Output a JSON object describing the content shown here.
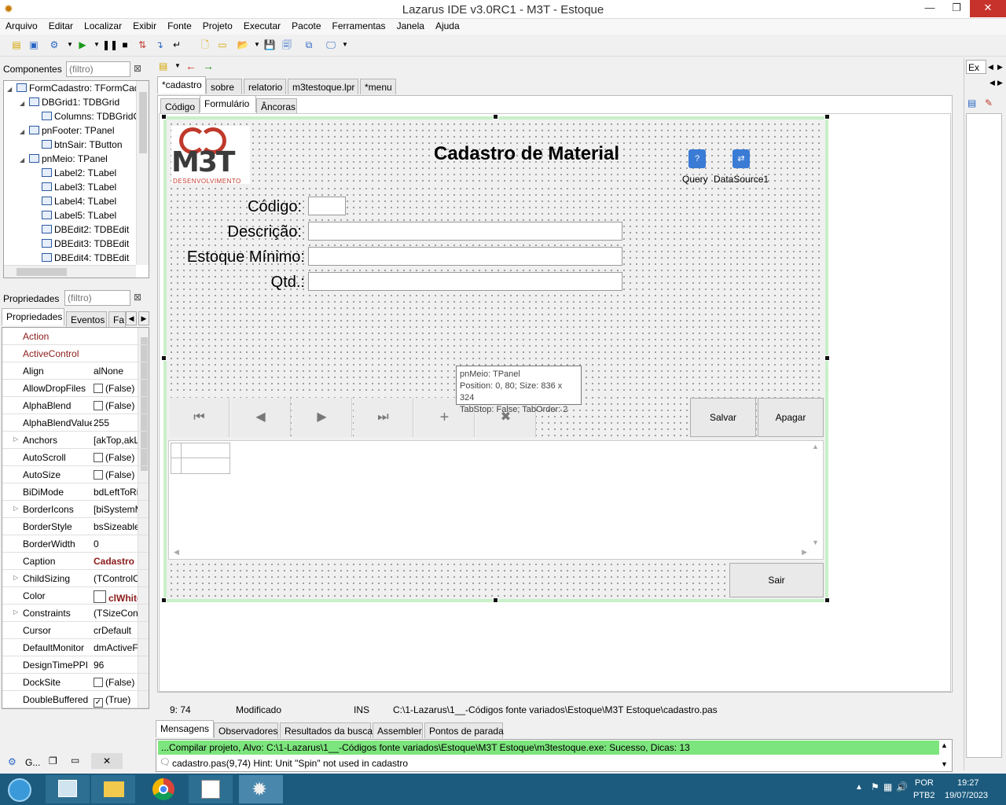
{
  "window": {
    "title": "Lazarus IDE v3.0RC1 - M3T - Estoque"
  },
  "menu": [
    "Arquivo",
    "Editar",
    "Localizar",
    "Exibir",
    "Fonte",
    "Projeto",
    "Executar",
    "Pacote",
    "Ferramentas",
    "Janela",
    "Ajuda"
  ],
  "components": {
    "label": "Componentes",
    "filter_placeholder": "(filtro)",
    "tree": [
      {
        "text": "FormCadastro: TFormCadastro",
        "level": 0,
        "exp": "◢"
      },
      {
        "text": "DBGrid1: TDBGrid",
        "level": 1,
        "exp": "◢"
      },
      {
        "text": "Columns: TDBGridColumns",
        "level": 2,
        "exp": ""
      },
      {
        "text": "pnFooter: TPanel",
        "level": 1,
        "exp": "◢"
      },
      {
        "text": "btnSair: TButton",
        "level": 2,
        "exp": ""
      },
      {
        "text": "pnMeio: TPanel",
        "level": 1,
        "exp": "◢"
      },
      {
        "text": "Label2: TLabel",
        "level": 2,
        "exp": ""
      },
      {
        "text": "Label3: TLabel",
        "level": 2,
        "exp": ""
      },
      {
        "text": "Label4: TLabel",
        "level": 2,
        "exp": ""
      },
      {
        "text": "Label5: TLabel",
        "level": 2,
        "exp": ""
      },
      {
        "text": "DBEdit2: TDBEdit",
        "level": 2,
        "exp": ""
      },
      {
        "text": "DBEdit3: TDBEdit",
        "level": 2,
        "exp": ""
      },
      {
        "text": "DBEdit4: TDBEdit",
        "level": 2,
        "exp": ""
      }
    ]
  },
  "properties": {
    "label": "Propriedades",
    "filter_placeholder": "(filtro)",
    "tabs": [
      "Propriedades",
      "Eventos",
      "Fa"
    ],
    "rows": [
      {
        "name": "Action",
        "value": "",
        "red": true
      },
      {
        "name": "ActiveControl",
        "value": "",
        "red": true
      },
      {
        "name": "Align",
        "value": "alNone"
      },
      {
        "name": "AllowDropFiles",
        "value": "(False)",
        "check": true
      },
      {
        "name": "AlphaBlend",
        "value": "(False)",
        "check": true
      },
      {
        "name": "AlphaBlendValue",
        "value": "255"
      },
      {
        "name": "Anchors",
        "value": "[akTop,akLeft]",
        "exp": true
      },
      {
        "name": "AutoScroll",
        "value": "(False)",
        "check": true
      },
      {
        "name": "AutoSize",
        "value": "(False)",
        "check": true
      },
      {
        "name": "BiDiMode",
        "value": "bdLeftToRight"
      },
      {
        "name": "BorderIcons",
        "value": "[biSystemMenu]",
        "exp": true
      },
      {
        "name": "BorderStyle",
        "value": "bsSizeable"
      },
      {
        "name": "BorderWidth",
        "value": "0"
      },
      {
        "name": "Caption",
        "value": "Cadastro de Material",
        "boldred": true
      },
      {
        "name": "ChildSizing",
        "value": "(TControlChildSizing)",
        "exp": true
      },
      {
        "name": "Color",
        "value": "clWhite",
        "color": true
      },
      {
        "name": "Constraints",
        "value": "(TSizeConstraints)",
        "exp": true
      },
      {
        "name": "Cursor",
        "value": "crDefault"
      },
      {
        "name": "DefaultMonitor",
        "value": "dmActiveForm"
      },
      {
        "name": "DesignTimePPI",
        "value": "96"
      },
      {
        "name": "DockSite",
        "value": "(False)",
        "check": true
      },
      {
        "name": "DoubleBuffered",
        "value": "(True)",
        "check": true,
        "checked": true
      }
    ]
  },
  "bottom_left": {
    "label": "G..."
  },
  "editor": {
    "tabs": [
      "*cadastro",
      "sobre",
      "relatorio",
      "m3testoque.lpr",
      "*menu"
    ],
    "subtabs": [
      "Código",
      "Formulário",
      "Âncoras"
    ]
  },
  "form": {
    "title": "Cadastro de Material",
    "logo_text": "M3T",
    "logo_sub": "DESENVOLVIMENTO",
    "query_label": "Query",
    "datasource_label": "DataSource1",
    "labels": [
      "Código:",
      "Descrição:",
      "Estoque Mínimo:",
      "Qtd.:"
    ],
    "nav": [
      "⏮",
      "◀",
      "▶",
      "⏭",
      "+",
      "✖"
    ],
    "salvar": "Salvar",
    "apagar": "Apagar",
    "sair": "Sair",
    "hint_lines": [
      "pnMeio: TPanel",
      "Position: 0, 80; Size: 836 x 324",
      "TabStop: False; TabOrder: 2"
    ]
  },
  "status": {
    "pos": "9:  74",
    "state": "Modificado",
    "mode": "INS",
    "file": "C:\\1-Lazarus\\1__-Códigos fonte variados\\Estoque\\M3T Estoque\\cadastro.pas"
  },
  "messages": {
    "tabs": [
      "Mensagens",
      "Observadores",
      "Resultados da busca",
      "Assembler",
      "Pontos de parada"
    ],
    "line1": "...Compilar projeto, Alvo: C:\\1-Lazarus\\1__-Códigos fonte variados\\Estoque\\M3T Estoque\\m3testoque.exe: Sucesso, Dicas: 13",
    "line2": "cadastro.pas(9,74) Hint: Unit \"Spin\" not used in cadastro"
  },
  "right_panel": {
    "label": "Ex"
  },
  "taskbar": {
    "lang": "POR",
    "kbd": "PTB2",
    "time": "19:27",
    "date": "19/07/2023"
  }
}
